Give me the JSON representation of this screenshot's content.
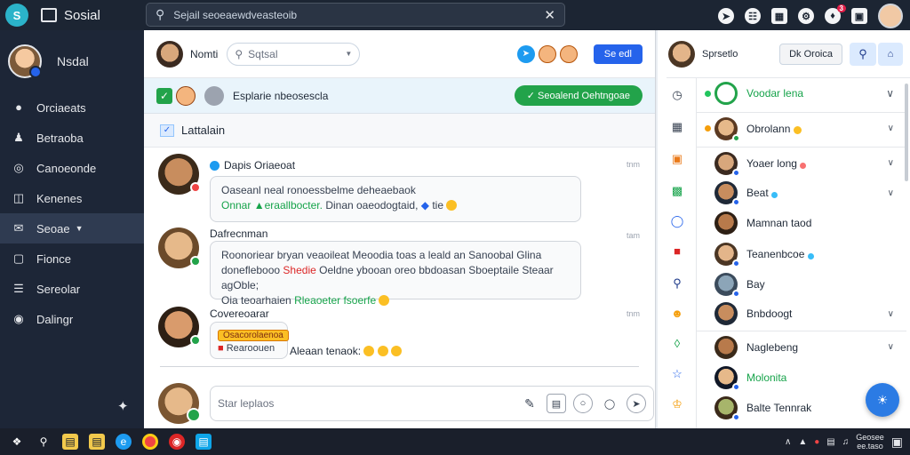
{
  "topbar": {
    "app_title": "Sosial",
    "search_text": "Sejail seoeaewdveasteoib",
    "notification_count": "3"
  },
  "sidebar": {
    "user_name": "Nsdal",
    "items": [
      {
        "label": "Orciaeats",
        "icon": "people-icon"
      },
      {
        "label": "Betraoba",
        "icon": "person-icon"
      },
      {
        "label": "Canoeonde",
        "icon": "compass-icon"
      },
      {
        "label": "Kenenes",
        "icon": "book-icon"
      },
      {
        "label": "Seoae",
        "icon": "chat-icon",
        "active": true
      },
      {
        "label": "Fionce",
        "icon": "document-icon"
      },
      {
        "label": "Sereolar",
        "icon": "list-icon"
      },
      {
        "label": "Dalingr",
        "icon": "camera-icon"
      }
    ]
  },
  "middle": {
    "header_name": "Nomti",
    "search_placeholder": "Sqtsal",
    "header_button": "Se edl",
    "group_text": "Esplarie nbeosescla",
    "group_button": "Seoalend Oehtngoae",
    "channel_title": "Lattalain",
    "messages": [
      {
        "author": "Dapis Oriaeoat",
        "time": "tnm",
        "line1": "Oaseanl neal ronoessbelme deheaebaok",
        "line2_green": "Onnar",
        "line2_green2": "eraallbocter.",
        "line2_rest": "Dinan oaeodogtaid,",
        "line2_end": "tie"
      },
      {
        "author": "Dafrecnman",
        "time": "tam",
        "line1": "Roonoriear bryan veaoileat Meoodia toas a leald an Sanoobal Glina",
        "line2_a": "doneflebooo",
        "line2_red": "Shedie",
        "line2_b": "Oeldne ybooan oreo bbdoasan Sboeptaile Steaar agOble;",
        "line3_a": "Oia teoarhaien",
        "line3_green": "Rleaoeter fsoerfe"
      },
      {
        "author": "Covereoarar",
        "time": "tnm",
        "tag": "Osacorolaenoa",
        "reply_label": "Rearoouen",
        "inline_text": "Aleaan tenaok:"
      }
    ],
    "composer_placeholder": "Star leplaos"
  },
  "rpanel": {
    "header_name": "Sprsetlo",
    "header_button": "Dk Oroica",
    "contacts": [
      {
        "name": "Voodar lena",
        "dot": "#22c55e",
        "status": "#22a34a",
        "green": true
      },
      {
        "name": "Obrolann",
        "dot": "#f59e0b",
        "status": "#22a34a"
      },
      {
        "name": "Yoaer long",
        "dot": null,
        "status": "#2563eb"
      },
      {
        "name": "Beat",
        "dot": null,
        "status": "#2563eb"
      },
      {
        "name": "Mamnan taod",
        "dot": null,
        "status": null
      },
      {
        "name": "Teanenbcoe",
        "dot": null,
        "status": "#2563eb"
      },
      {
        "name": "Bay",
        "dot": null,
        "status": "#2563eb"
      },
      {
        "name": "Bnbdoogt",
        "dot": null,
        "status": null
      },
      {
        "name": "Naglebeng",
        "dot": null,
        "status": null
      },
      {
        "name": "Molonita",
        "dot": null,
        "status": "#2563eb",
        "green": true
      },
      {
        "name": "Balte Tennrak",
        "dot": null,
        "status": "#2563eb"
      }
    ]
  },
  "taskbar": {
    "time": "Geosee",
    "date": "ee.taso"
  }
}
